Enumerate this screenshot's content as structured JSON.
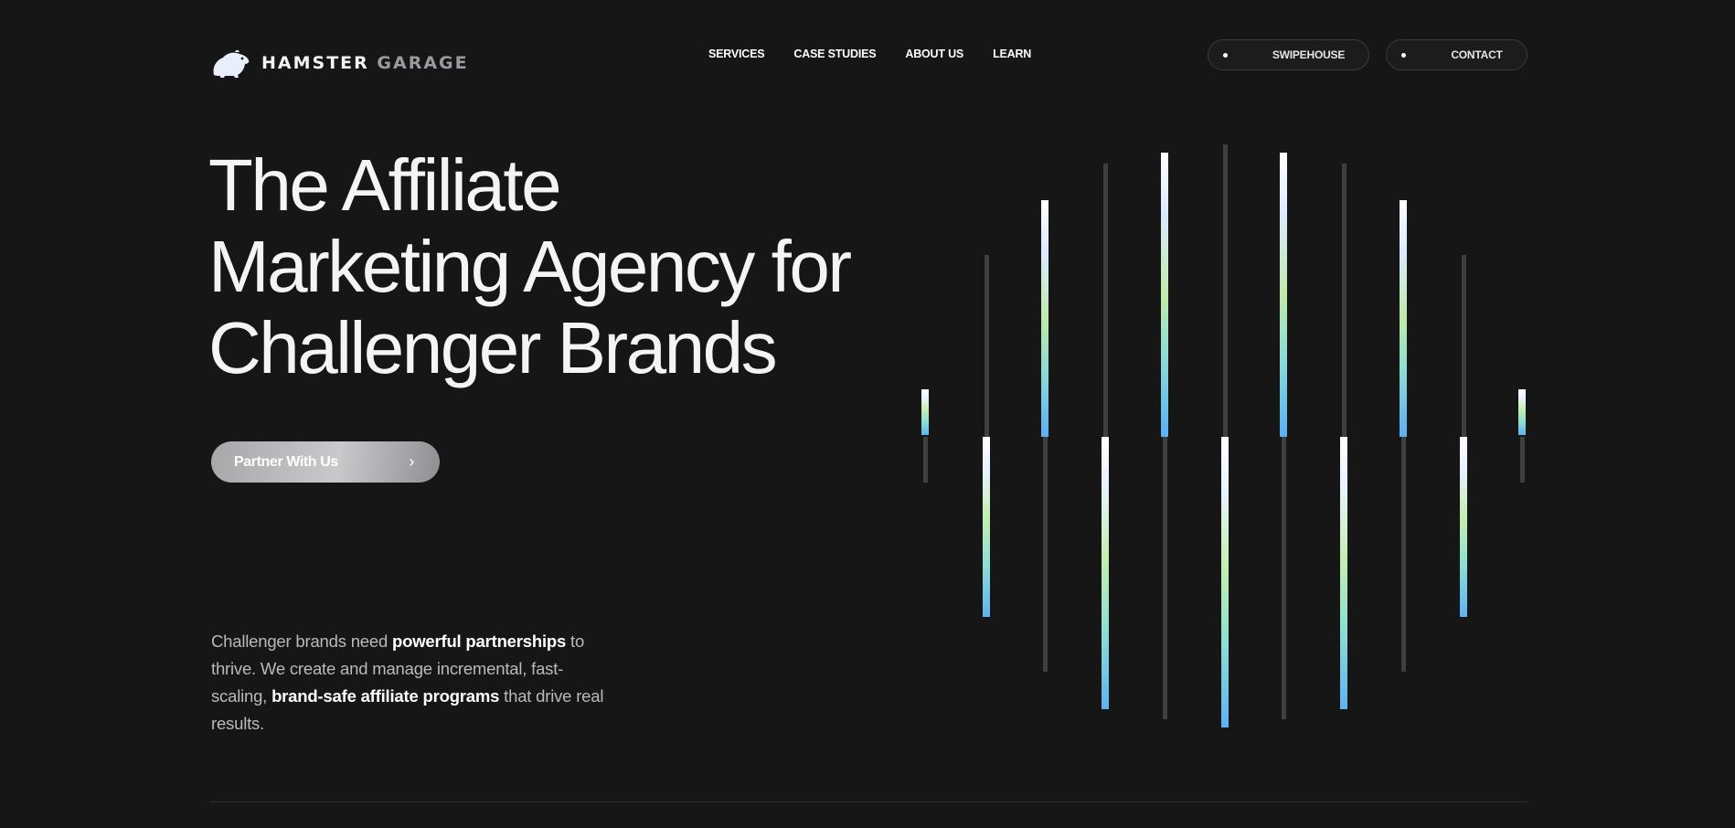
{
  "brand": {
    "name_primary": "HAMSTER",
    "name_secondary": "GARAGE",
    "logo_icon": "hamster-icon"
  },
  "nav": {
    "items": [
      {
        "label": "SERVICES"
      },
      {
        "label": "CASE STUDIES"
      },
      {
        "label": "ABOUT US"
      },
      {
        "label": "LEARN"
      }
    ],
    "swipehouse_label": "SWIPEHOUSE",
    "contact_label": "CONTACT"
  },
  "hero": {
    "title_lines": [
      "The Affiliate",
      "Marketing Agency for",
      "Challenger Brands"
    ],
    "cta_label": "Partner With Us",
    "cta_icon": "chevron-right-icon"
  },
  "intro": {
    "part1": "Challenger brands need ",
    "bold1": "powerful partnerships",
    "part2": " to thrive. We create and manage incremental, fast-scaling, ",
    "bold2": "brand-safe affiliate programs",
    "part3": " that drive real results."
  },
  "colors": {
    "background": "#161616",
    "text": "#f4f4f6",
    "muted_text": "#b9b9be",
    "bar_grey": "#3f3f41",
    "gradient_top": "#ffffff",
    "gradient_mid": "#c4eeb0",
    "gradient_bottom": "#5fb2f2"
  }
}
